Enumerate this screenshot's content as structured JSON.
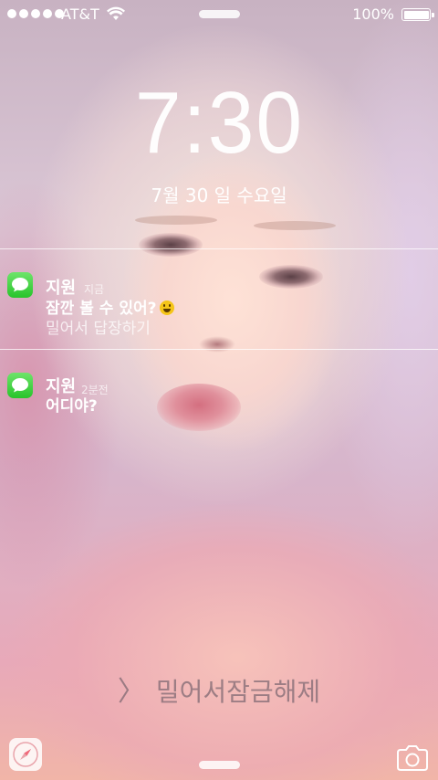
{
  "status_bar": {
    "carrier": "AT&T",
    "battery": "100%"
  },
  "lock_screen": {
    "time": "7:30",
    "date": "7월 30 일 수요일",
    "unlock_text": "밀어서잠금해제"
  },
  "notifications": [
    {
      "app_icon": "messages-icon",
      "sender": "지원",
      "time": "지금",
      "message": "잠깐 볼 수 있어?",
      "action": "밀어서 답장하기"
    },
    {
      "app_icon": "messages-icon",
      "sender": "지원",
      "time": "2분전",
      "message": "어디야?"
    }
  ],
  "colors": {
    "messages_green": "#34c759",
    "text": "#ffffff"
  }
}
